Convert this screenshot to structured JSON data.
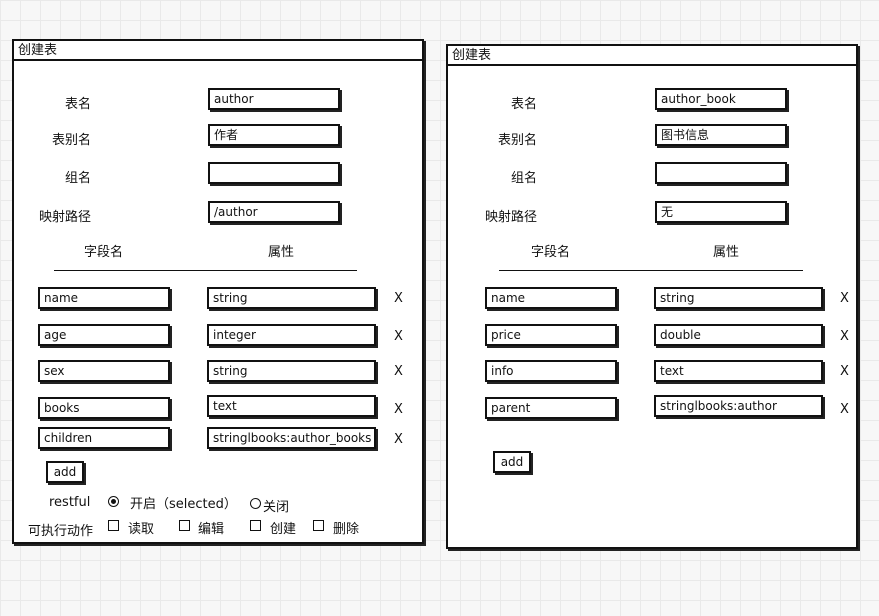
{
  "left": {
    "title": "创建表",
    "table_name_label": "表名",
    "table_name_value": "author",
    "alias_label": "表别名",
    "alias_value": "作者",
    "group_label": "组名",
    "group_value": "",
    "path_label": "映射路径",
    "path_value": "/author",
    "col_field": "字段名",
    "col_attr": "属性",
    "fields": [
      {
        "name": "name",
        "attr": "string",
        "delete": "X"
      },
      {
        "name": "age",
        "attr": "integer",
        "delete": "X"
      },
      {
        "name": "sex",
        "attr": "string",
        "delete": "X"
      },
      {
        "name": "books",
        "attr": "text",
        "delete": "X"
      },
      {
        "name": "children",
        "attr": "stringlbooks:author_books",
        "delete": "X"
      }
    ],
    "add_label": "add",
    "restful_label": "restful",
    "restful_on": "开启（selected）",
    "restful_off": "关闭",
    "actions_label": "可执行动作",
    "actions": [
      "读取",
      "编辑",
      "创建",
      "删除"
    ]
  },
  "right": {
    "title": "创建表",
    "table_name_label": "表名",
    "table_name_value": "author_book",
    "alias_label": "表别名",
    "alias_value": "图书信息",
    "group_label": "组名",
    "group_value": "",
    "path_label": "映射路径",
    "path_value": "无",
    "col_field": "字段名",
    "col_attr": "属性",
    "fields": [
      {
        "name": "name",
        "attr": "string",
        "delete": "X"
      },
      {
        "name": "price",
        "attr": "double",
        "delete": "X"
      },
      {
        "name": "info",
        "attr": "text",
        "delete": "X"
      },
      {
        "name": "parent",
        "attr": "stringlbooks:author",
        "delete": "X"
      }
    ],
    "add_label": "add"
  }
}
